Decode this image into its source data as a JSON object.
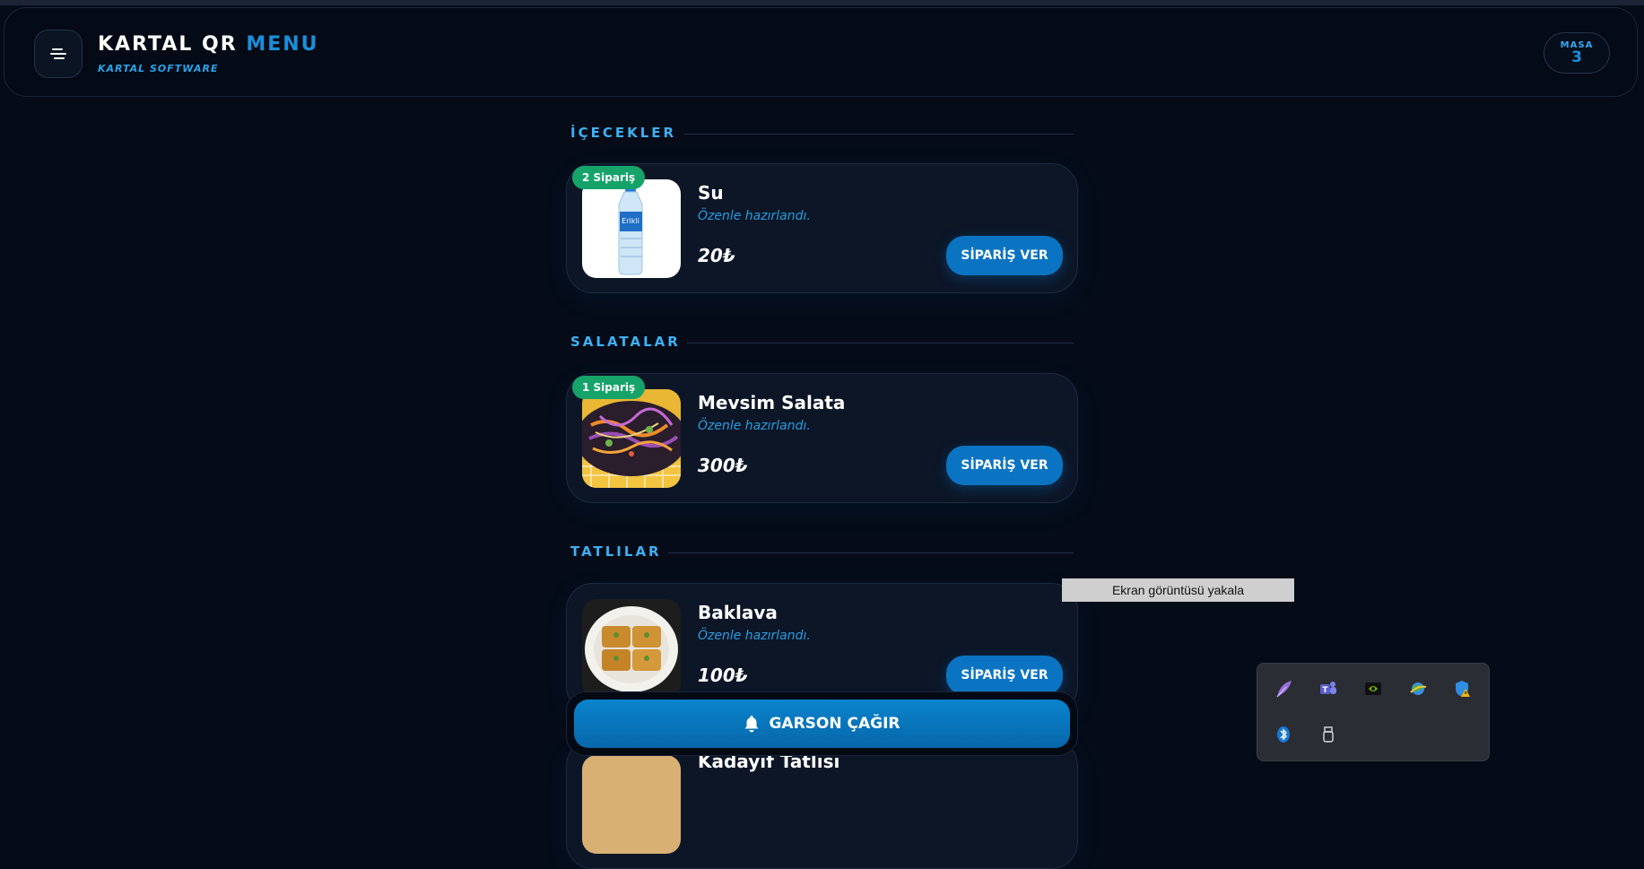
{
  "header": {
    "brand_main": "KARTAL QR",
    "brand_accent": "MENU",
    "brand_sub": "KARTAL SOFTWARE",
    "table_label": "MASA",
    "table_number": "3"
  },
  "sections": [
    {
      "title": "İÇECEKLER",
      "item": {
        "badge": "2 Sipariş",
        "name": "Su",
        "desc": "Özenle hazırlandı.",
        "price": "20₺",
        "button": "SİPARİŞ VER",
        "image": "water-bottle"
      }
    },
    {
      "title": "SALATALAR",
      "item": {
        "badge": "1 Sipariş",
        "name": "Mevsim Salata",
        "desc": "Özenle hazırlandı.",
        "price": "300₺",
        "button": "SİPARİŞ VER",
        "image": "salad"
      }
    },
    {
      "title": "TATLILAR",
      "item": {
        "name": "Baklava",
        "desc": "Özenle hazırlandı.",
        "price": "100₺",
        "button": "SİPARİŞ VER",
        "image": "baklava"
      },
      "next_item_name": "Kadayıf Tatlısı"
    }
  ],
  "call_waiter": {
    "label": "GARSON ÇAĞIR",
    "icon": "bell-icon"
  },
  "tooltip": "Ekran görüntüsü yakala",
  "tray_icons": [
    "feather-icon",
    "teams-icon",
    "nvidia-icon",
    "network-globe-icon",
    "security-shield-warning-icon",
    "bluetooth-icon",
    "usb-drive-icon"
  ],
  "colors": {
    "accent": "#1a8fdb",
    "badge_green": "#16a36a",
    "background": "#050c18"
  }
}
